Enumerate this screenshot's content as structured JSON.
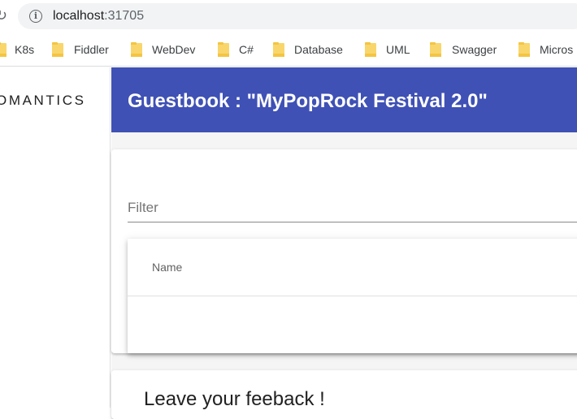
{
  "browser": {
    "url_host": "localhost",
    "url_port": ":31705",
    "bookmarks": [
      "K8s",
      "Fiddler",
      "WebDev",
      "C#",
      "Database",
      "UML",
      "Swagger",
      "Micros"
    ]
  },
  "app": {
    "brand": "OMANTICS",
    "header_title": "Guestbook : \"MyPopRock Festival 2.0\"",
    "filter_placeholder": "Filter",
    "table": {
      "columns": [
        "Name"
      ]
    },
    "feedback_title": "Leave your feeback !"
  },
  "colors": {
    "header": "#3f51b5",
    "background": "#f5f5f5",
    "folder": "#f9d66b"
  },
  "icons": {
    "reload": "reload-icon",
    "info": "info-icon",
    "bookmark": "folder-icon"
  }
}
